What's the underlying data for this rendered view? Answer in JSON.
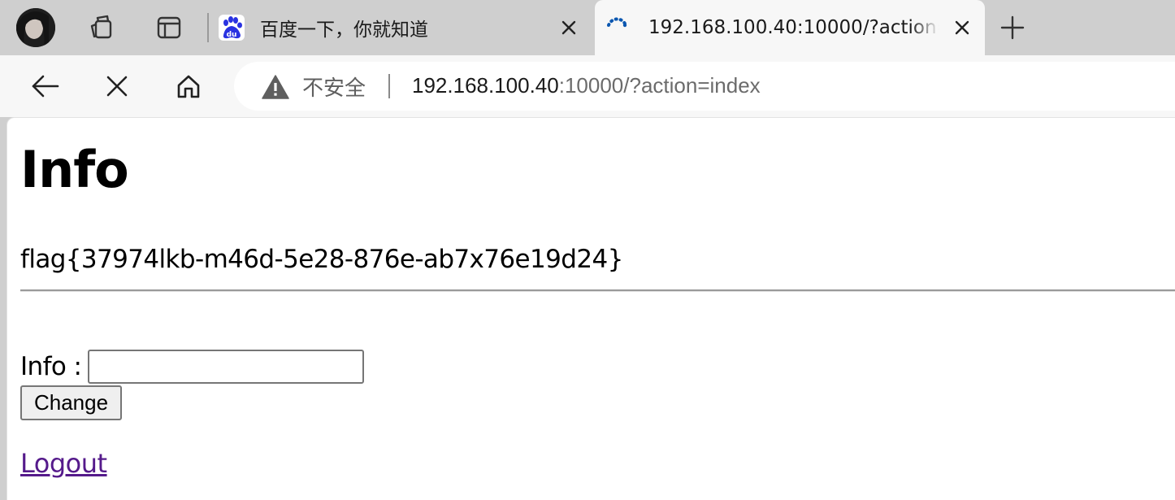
{
  "browser": {
    "tabs": [
      {
        "title": "百度一下，你就知道",
        "favicon": "baidu-paw-icon",
        "active": false
      },
      {
        "title": "192.168.100.40:10000/?action=index",
        "favicon": "loading-spinner-icon",
        "active": true
      }
    ],
    "security_label": "不安全",
    "url_host": "192.168.100.40",
    "url_rest": ":10000/?action=index"
  },
  "page": {
    "title": "Info",
    "flag": "flag{37974lkb-m46d-5e28-876e-ab7x76e19d24}",
    "info_label": "Info :",
    "info_value": "",
    "change_button": "Change",
    "logout_link": "Logout"
  },
  "colors": {
    "tab_strip_bg": "#cfcfcf",
    "toolbar_bg": "#f7f7f7",
    "baidu_blue": "#2932e1",
    "spinner_blue": "#0b57b0",
    "visited_link": "#551a8b"
  }
}
